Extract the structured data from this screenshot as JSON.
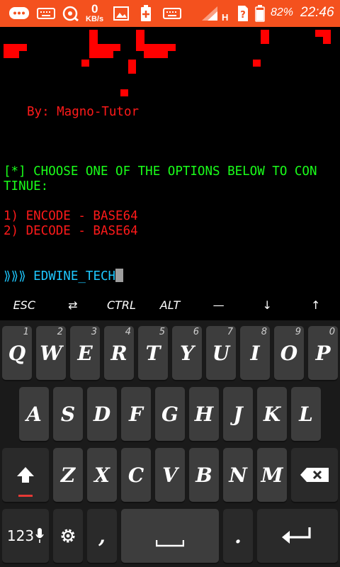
{
  "status_bar": {
    "net_speed_value": "0",
    "net_speed_unit": "KB/s",
    "network_type": "H",
    "battery_percent": "82%",
    "time": "22:46",
    "bg_color": "#f4511e"
  },
  "terminal": {
    "byline": "By: Magno-Tutor",
    "prompt_line_1": "[*] CHOOSE ONE OF THE OPTIONS BELOW TO CON",
    "prompt_line_2": "TINUE:",
    "option_1": "1) ENCODE - BASE64",
    "option_2": "2) DECODE - BASE64",
    "shell_prompt": "⟫⟫⟫",
    "input_text": "EDWINE_TECH"
  },
  "extra_keys": {
    "esc": "ESC",
    "tab": "⇄",
    "ctrl": "CTRL",
    "alt": "ALT",
    "dash": "—",
    "down": "↓",
    "up": "↑"
  },
  "keyboard": {
    "row1": [
      {
        "label": "Q",
        "hint": "1"
      },
      {
        "label": "W",
        "hint": "2"
      },
      {
        "label": "E",
        "hint": "3"
      },
      {
        "label": "R",
        "hint": "4"
      },
      {
        "label": "T",
        "hint": "5"
      },
      {
        "label": "Y",
        "hint": "6"
      },
      {
        "label": "U",
        "hint": "7"
      },
      {
        "label": "I",
        "hint": "8"
      },
      {
        "label": "O",
        "hint": "9"
      },
      {
        "label": "P",
        "hint": "0"
      }
    ],
    "row2": [
      "A",
      "S",
      "D",
      "F",
      "G",
      "H",
      "J",
      "K",
      "L"
    ],
    "row3": [
      "Z",
      "X",
      "C",
      "V",
      "B",
      "N",
      "M"
    ],
    "numbers_label": "123",
    "comma": ",",
    "period": ".",
    "accent_color": "#e53935"
  }
}
